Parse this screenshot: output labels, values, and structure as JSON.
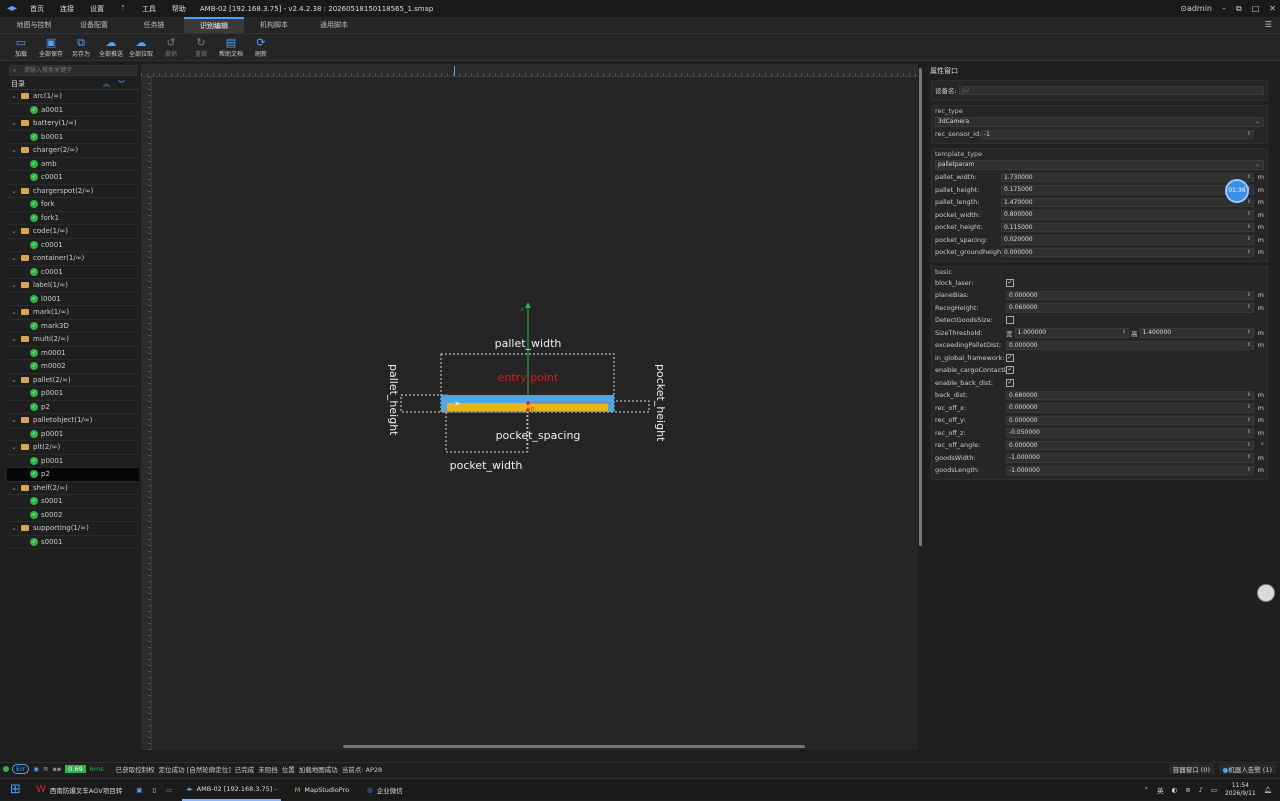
{
  "app": {
    "title": "AMB-02 [192.168.3.75] - v2.4.2.38 : 20260518150118565_1.smap",
    "menu": [
      "首页",
      "连接",
      "设置",
      "工具",
      "帮助"
    ],
    "user": "admin"
  },
  "tabs": [
    "地图与控制",
    "设备配置",
    "任务链",
    "识别编辑",
    "机构脚本",
    "通用脚本"
  ],
  "active_tab": "识别编辑",
  "toolbar": [
    {
      "label": "加载",
      "icon": "folder-open-icon"
    },
    {
      "label": "全部保存",
      "icon": "save-icon"
    },
    {
      "label": "另存为",
      "icon": "save-as-icon"
    },
    {
      "label": "全部推送",
      "icon": "cloud-upload-icon"
    },
    {
      "label": "全部拉取",
      "icon": "cloud-download-icon"
    },
    {
      "label": "撤销",
      "icon": "undo-icon"
    },
    {
      "label": "重做",
      "icon": "redo-icon"
    },
    {
      "label": "帮助文档",
      "icon": "document-icon"
    },
    {
      "label": "刷新",
      "icon": "refresh-icon"
    }
  ],
  "sidebar": {
    "search_placeholder": "请输入搜索关键字",
    "dir_label": "目录",
    "groups": [
      {
        "name": "arc(1/∞)",
        "items": [
          "a0001"
        ]
      },
      {
        "name": "battery(1/∞)",
        "items": [
          "b0001"
        ]
      },
      {
        "name": "charger(2/∞)",
        "items": [
          "amb",
          "c0001"
        ]
      },
      {
        "name": "chargerspot(2/∞)",
        "items": [
          "fork",
          "fork1"
        ]
      },
      {
        "name": "code(1/∞)",
        "items": [
          "c0001"
        ]
      },
      {
        "name": "container(1/∞)",
        "items": [
          "c0001"
        ]
      },
      {
        "name": "label(1/∞)",
        "items": [
          "l0001"
        ]
      },
      {
        "name": "mark(1/∞)",
        "items": [
          "mark3D"
        ]
      },
      {
        "name": "multi(2/∞)",
        "items": [
          "m0001",
          "m0002"
        ]
      },
      {
        "name": "pallet(2/∞)",
        "items": [
          "p0001",
          "p2"
        ]
      },
      {
        "name": "palletobject(1/∞)",
        "items": [
          "p0001"
        ]
      },
      {
        "name": "plt(2/∞)",
        "items": [
          "p0001",
          "p2"
        ]
      },
      {
        "name": "shelf(2/∞)",
        "items": [
          "s0001",
          "s0002"
        ]
      },
      {
        "name": "supporting(1/∞)",
        "items": [
          "s0001"
        ]
      }
    ],
    "selected": "p2"
  },
  "diagram": {
    "labels": {
      "pallet_width": "pallet_width",
      "entry_point": "entry point",
      "pallet_height": "pallet_height",
      "pocket_height": "pocket_height",
      "pocket_spacing": "pocket_spacing",
      "pocket_width": "pocket_width",
      "axis_z": "z",
      "origin": "0"
    },
    "colors": {
      "pallet_blue": "#4aa8e8",
      "pocket_yellow": "#e8b418",
      "entry_red": "#e02020",
      "axis_green": "#2fb344"
    }
  },
  "props": {
    "title": "属性窗口",
    "device_name_label": "设备名:",
    "device_name_value": "p2",
    "rec_type_group": "rec_type",
    "rec_type_value": "3dCamera",
    "rec_sensor_id_label": "rec_sensor_id:",
    "rec_sensor_id_value": "-1",
    "template_type_group": "template_type",
    "template_type_value": "palletparam",
    "template_rows": [
      {
        "label": "pallet_width:",
        "value": "1.730000",
        "unit": "m"
      },
      {
        "label": "pallet_height:",
        "value": "0.175000",
        "unit": "m"
      },
      {
        "label": "pallet_length:",
        "value": "1.470000",
        "unit": "m"
      },
      {
        "label": "pocket_width:",
        "value": "0.800000",
        "unit": "m"
      },
      {
        "label": "pocket_height:",
        "value": "0.115000",
        "unit": "m"
      },
      {
        "label": "pocket_spacing:",
        "value": "0.020000",
        "unit": "m"
      },
      {
        "label": "pocket_groundheight:",
        "value": "0.000000",
        "unit": "m"
      }
    ],
    "basic_group": "basic",
    "basic_rows": [
      {
        "label": "block_laser:",
        "type": "check",
        "checked": true
      },
      {
        "label": "planeBias:",
        "type": "num",
        "value": "0.000000",
        "unit": "m"
      },
      {
        "label": "RecogHeight:",
        "type": "num",
        "value": "0.060000",
        "unit": "m"
      },
      {
        "label": "DetectGoodsSize:",
        "type": "check",
        "checked": false
      },
      {
        "label": "SizeThreshold:",
        "type": "pair",
        "a_label": "宽",
        "a_value": "1.000000",
        "b_label": "高",
        "b_value": "1.400000",
        "unit": "m"
      },
      {
        "label": "exceedingPalletDist:",
        "type": "num",
        "value": "0.000000",
        "unit": "m"
      },
      {
        "label": "in_global_framework:",
        "type": "check",
        "checked": true
      },
      {
        "label": "enable_cargoContactDi",
        "type": "check",
        "checked": true
      },
      {
        "label": "enable_back_dist:",
        "type": "check",
        "checked": true
      },
      {
        "label": "back_dist:",
        "type": "num",
        "value": "0.680000",
        "unit": "m"
      },
      {
        "label": "rec_off_x:",
        "type": "num",
        "value": "0.000000",
        "unit": "m"
      },
      {
        "label": "rec_off_y:",
        "type": "num",
        "value": "0.000000",
        "unit": "m"
      },
      {
        "label": "rec_off_z:",
        "type": "num",
        "value": "-0.050000",
        "unit": "m"
      },
      {
        "label": "rec_off_angle:",
        "type": "num",
        "value": "0.000000",
        "unit": "°"
      },
      {
        "label": "goodsWidth:",
        "type": "num",
        "value": "-1.000000",
        "unit": "m"
      },
      {
        "label": "goodsLength:",
        "type": "num",
        "value": "-1.000000",
        "unit": "m"
      }
    ],
    "timer": "01:36"
  },
  "status": {
    "left": [
      "Err",
      "0.69",
      "6ms",
      "已获取控制权",
      "定位成功 [自然轮廓定位]",
      "已完成",
      "未阻挡",
      "位置",
      "加载地图成功",
      "当前点: AP28"
    ],
    "right": [
      "容器窗口 (0)",
      "机器人告警 (1)"
    ]
  },
  "taskbar": {
    "items": [
      "西南防爆叉车AGV项目转",
      "AMB-02 [192.168.3.75] -",
      "MapStudioPro",
      "企业微信"
    ],
    "time": "11:54",
    "date": "2026/9/11",
    "lang": "英"
  }
}
